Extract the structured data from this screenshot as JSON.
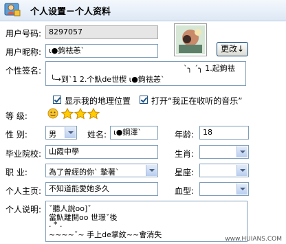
{
  "header": {
    "title": "个人设置－个人资料",
    "icon": "user-settings-icon"
  },
  "form": {
    "user_id_label": "用户号码:",
    "user_id_value": "8297057",
    "nickname_label": "用户昵称:",
    "nickname_value": "ι●鉤祛恙`",
    "change_button": "更改↓",
    "signature_label": "个性签名:",
    "signature_line1": "ˋ╮ ˊ╮ 1.起鉤祛",
    "signature_line2": "╰→到`1 2.个魞de世楔   ι●鉤祛恙`",
    "show_location_label": "显示我的地理位置",
    "show_music_label": "打开“我正在收听的音乐”",
    "level_label": "等    级:",
    "gender_label": "性    别:",
    "gender_value": "男",
    "name_label": "姓名:",
    "name_value": "ι●鋼澤`",
    "age_label": "年龄:",
    "age_value": "18",
    "school_label": "毕业院校:",
    "school_value": "山霞中學",
    "zodiac_label": "生肖:",
    "zodiac_value": "",
    "job_label": "职    业:",
    "job_value": "為了曾經的你` 摯著`",
    "constellation_label": "星座:",
    "constellation_value": "",
    "homepage_label": "个人主页:",
    "homepage_value": "不知道能愛她多久",
    "blood_label": "血型:",
    "blood_value": "",
    "bio_label": "个人说明:",
    "bio_line1": "ˇ聽人說oo]ˇ",
    "bio_line2": "    當魞離開oo 世璟ˇ後",
    "bio_line3": "                  .  *   .",
    "bio_line4": "    ~~~~ˇ~  手上de掌紋~~會消失"
  },
  "watermark": "www.HUIANS.COM"
}
